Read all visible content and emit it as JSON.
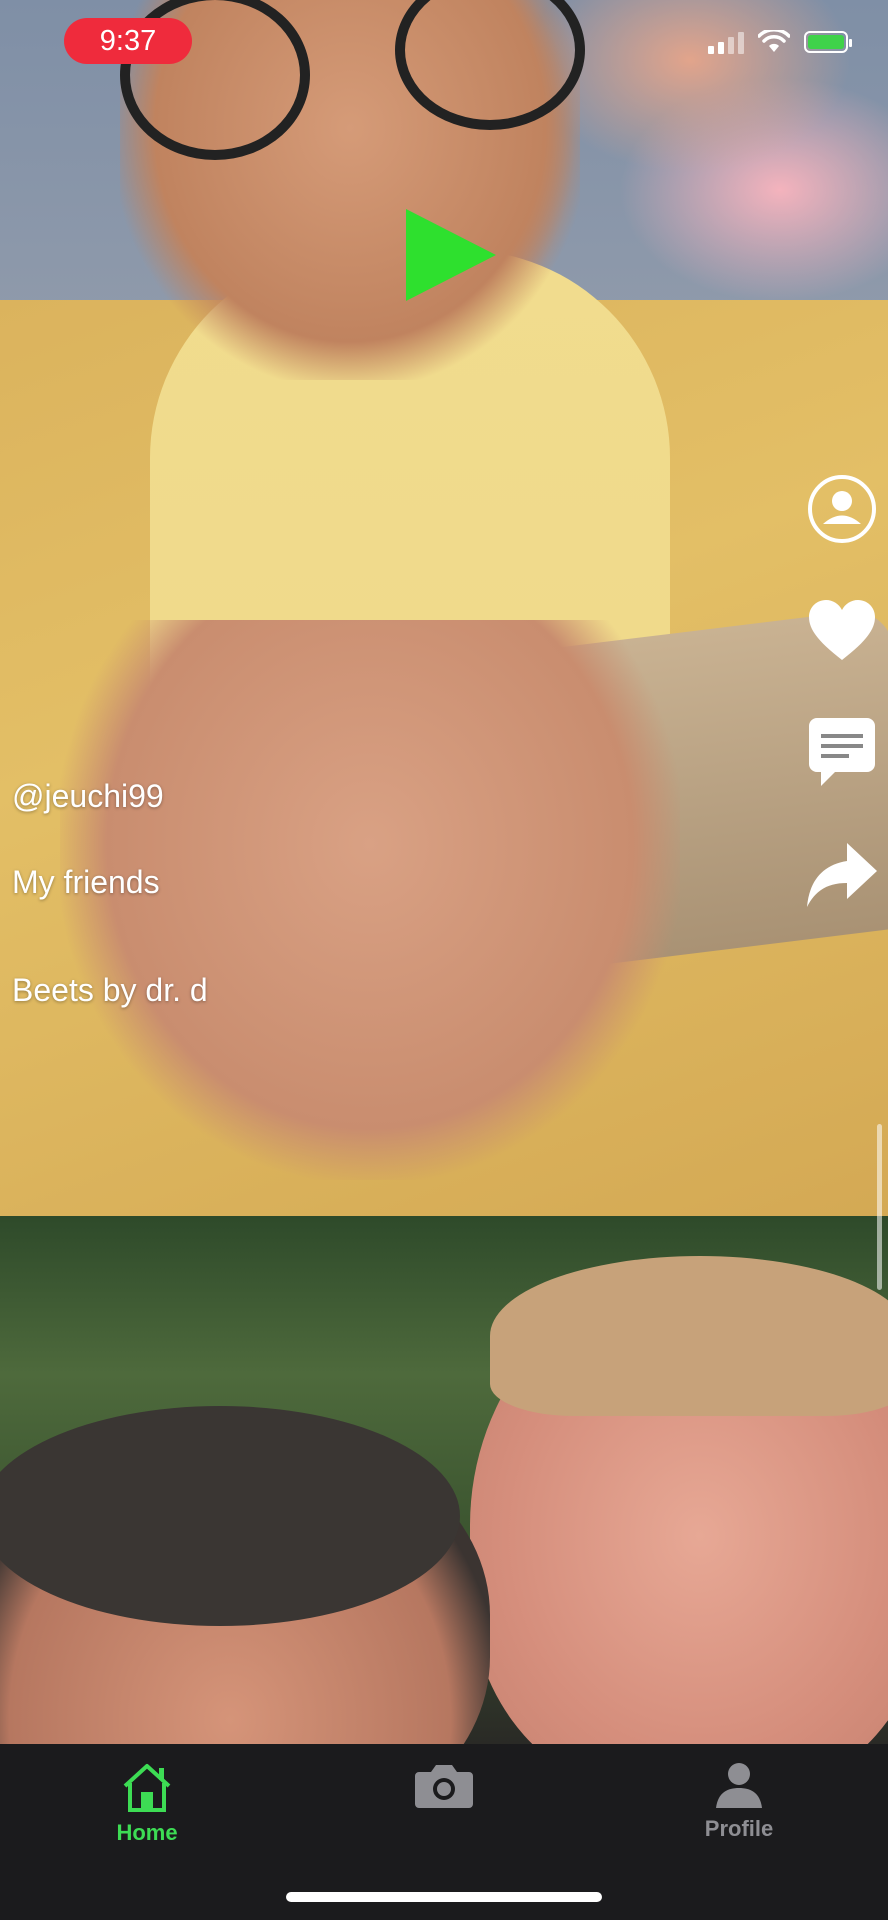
{
  "status_bar": {
    "time": "9:37",
    "battery_color": "#3fd24a",
    "recording_pill_color": "#ef2b3c"
  },
  "feed": {
    "current_video": {
      "username": "@jeuchi99",
      "description": "My friends",
      "song": "Beets by dr. d",
      "play_icon": "play-icon",
      "play_color": "#2ee02e"
    },
    "actions": [
      {
        "icon": "profile-circle-icon"
      },
      {
        "icon": "heart-icon"
      },
      {
        "icon": "comment-icon"
      },
      {
        "icon": "share-icon"
      }
    ]
  },
  "tab_bar": {
    "accent_color": "#3ddc54",
    "inactive_color": "#8e8e93",
    "tabs": [
      {
        "label": "Home",
        "icon": "home-icon",
        "active": true
      },
      {
        "label": "",
        "icon": "camera-icon",
        "active": false
      },
      {
        "label": "Profile",
        "icon": "profile-icon",
        "active": false
      }
    ]
  }
}
